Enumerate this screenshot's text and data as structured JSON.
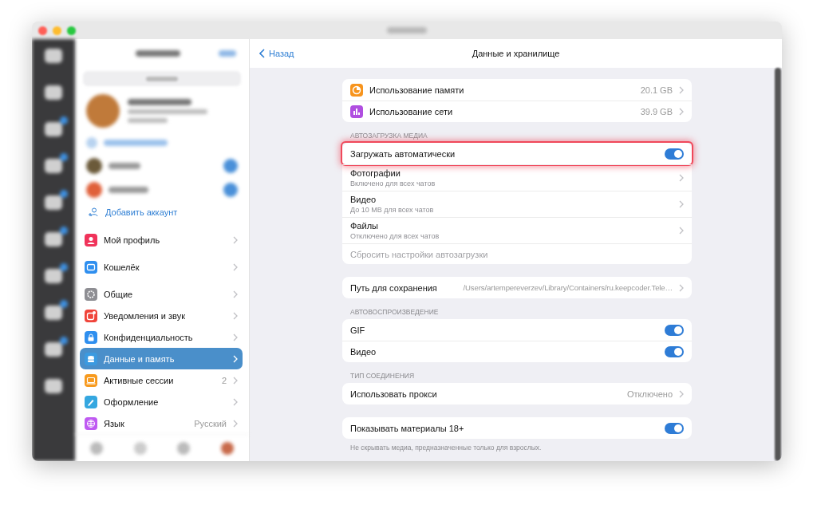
{
  "sidebar": {
    "add_account": "Добавить аккаунт",
    "groups": [
      [
        {
          "label": "Мой профиль",
          "color": "#f0335a",
          "selected": false
        }
      ],
      [
        {
          "label": "Кошелёк",
          "color": "#2f8fef",
          "selected": false
        }
      ],
      [
        {
          "label": "Общие",
          "color": "#8e8e93",
          "selected": false
        },
        {
          "label": "Уведомления и звук",
          "color": "#f0443a",
          "selected": false
        },
        {
          "label": "Конфиденциальность",
          "color": "#2f8fef",
          "selected": false
        },
        {
          "label": "Данные и память",
          "color": "#3b9ae0",
          "selected": true
        },
        {
          "label": "Активные сессии",
          "color": "#f79a1e",
          "selected": false,
          "value": "2"
        },
        {
          "label": "Оформление",
          "color": "#35a7e0",
          "selected": false
        },
        {
          "label": "Язык",
          "color": "#bf5af2",
          "selected": false,
          "value": "Русский"
        }
      ]
    ]
  },
  "main": {
    "back": "Назад",
    "title": "Данные и хранилище",
    "sections": [
      {
        "rows": [
          {
            "kind": "value",
            "label": "Использование памяти",
            "value": "20.1 GB",
            "color": "#f7941d"
          },
          {
            "kind": "value",
            "label": "Использование сети",
            "value": "39.9 GB",
            "color": "#b04fe0"
          }
        ]
      },
      {
        "header": "АВТОЗАГРУЗКА МЕДИА",
        "rows": [
          {
            "kind": "toggle",
            "label": "Загружать автоматически",
            "on": true,
            "highlighted": true
          },
          {
            "kind": "detail",
            "label": "Фотографии",
            "subtitle": "Включено для всех чатов"
          },
          {
            "kind": "detail",
            "label": "Видео",
            "subtitle": "До 10 MB для всех чатов"
          },
          {
            "kind": "detail",
            "label": "Файлы",
            "subtitle": "Отключено для всех чатов"
          },
          {
            "kind": "action",
            "label": "Сбросить настройки автозагрузки"
          }
        ]
      },
      {
        "rows": [
          {
            "kind": "value",
            "label": "Путь для сохранения",
            "value": "/Users/artempereverzev/Library/Containers/ru.keepcoder.Tele…"
          }
        ]
      },
      {
        "header": "АВТОВОСПРОИЗВЕДЕНИЕ",
        "rows": [
          {
            "kind": "toggle",
            "label": "GIF",
            "on": true,
            "highlighted": false
          },
          {
            "kind": "toggle",
            "label": "Видео",
            "on": true,
            "highlighted": false
          }
        ]
      },
      {
        "header": "ТИП СОЕДИНЕНИЯ",
        "rows": [
          {
            "kind": "value",
            "label": "Использовать прокси",
            "value": "Отключено"
          }
        ]
      },
      {
        "rows": [
          {
            "kind": "toggle",
            "label": "Показывать материалы 18+",
            "on": true,
            "highlighted": false
          }
        ],
        "footer": "Не скрывать медиа, предназначенные только для взрослых."
      }
    ]
  }
}
